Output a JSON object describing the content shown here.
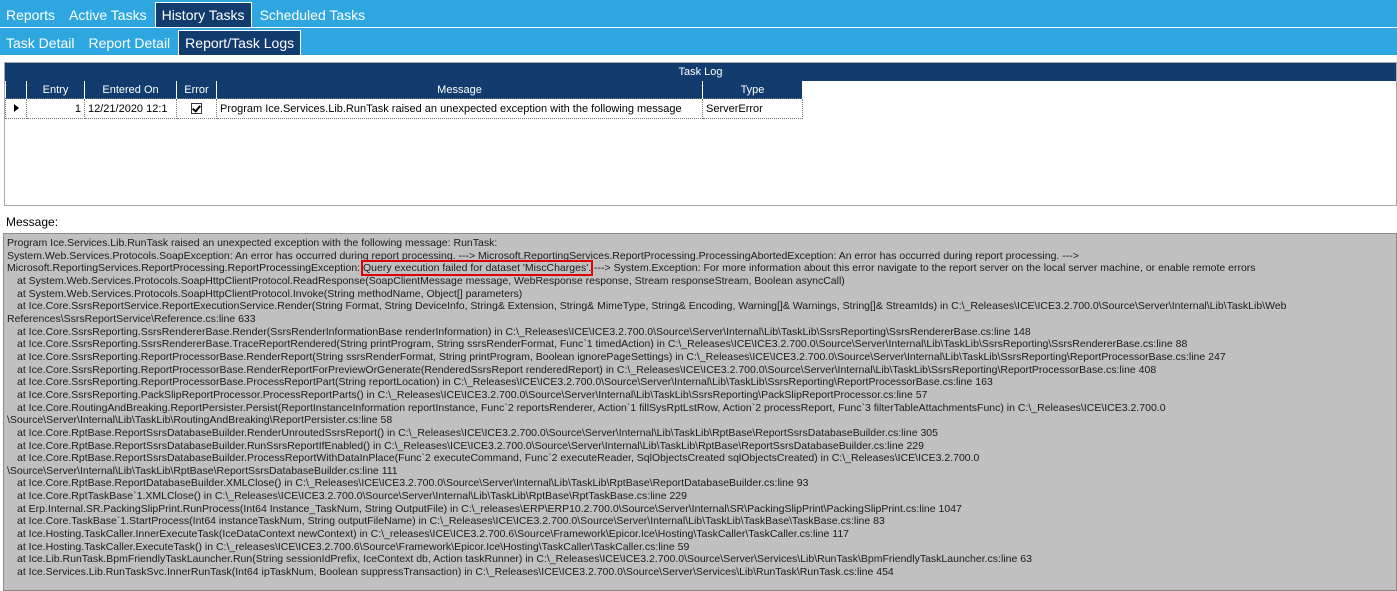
{
  "top_tabs": [
    {
      "label": "Reports",
      "active": false
    },
    {
      "label": "Active Tasks",
      "active": false
    },
    {
      "label": "History Tasks",
      "active": true
    },
    {
      "label": "Scheduled Tasks",
      "active": false
    }
  ],
  "sub_tabs": [
    {
      "label": "Task Detail",
      "active": false
    },
    {
      "label": "Report Detail",
      "active": false
    },
    {
      "label": "Report/Task Logs",
      "active": true
    }
  ],
  "task_log": {
    "caption": "Task Log",
    "columns": [
      "Entry",
      "Entered On",
      "Error",
      "Message",
      "Type"
    ],
    "rows": [
      {
        "entry": "1",
        "entered_on": "12/21/2020 12:1",
        "error": true,
        "message": "Program Ice.Services.Lib.RunTask raised an unexpected exception with the following message",
        "type": "ServerError"
      }
    ]
  },
  "message_label": "Message:",
  "message": {
    "l1": "Program Ice.Services.Lib.RunTask raised an unexpected exception with the following message: RunTask:",
    "l2": "System.Web.Services.Protocols.SoapException: An error has occurred during report processing. ---> Microsoft.ReportingServices.ReportProcessing.ProcessingAbortedException: An error has occurred during report processing. --->",
    "l3a": "Microsoft.ReportingServices.ReportProcessing.ReportProcessingException:",
    "l3b": "Query execution failed for dataset 'MiscCharges'.",
    "l3c": "---> System.Exception: For more information about this error navigate to the report server on the local server machine, or enable remote errors",
    "l4": "at System.Web.Services.Protocols.SoapHttpClientProtocol.ReadResponse(SoapClientMessage message, WebResponse response, Stream responseStream, Boolean asyncCall)",
    "l5": "at System.Web.Services.Protocols.SoapHttpClientProtocol.Invoke(String methodName, Object[] parameters)",
    "l6": "at Ice.Core.SsrsReportService.ReportExecutionService.Render(String Format, String DeviceInfo, String& Extension, String& MimeType, String& Encoding, Warning[]& Warnings, String[]& StreamIds) in C:\\_Releases\\ICE\\ICE3.2.700.0\\Source\\Server\\Internal\\Lib\\TaskLib\\Web",
    "l7": "References\\SsrsReportService\\Reference.cs:line 633",
    "l8": "at Ice.Core.SsrsReporting.SsrsRendererBase.Render(SsrsRenderInformationBase renderInformation) in C:\\_Releases\\ICE\\ICE3.2.700.0\\Source\\Server\\Internal\\Lib\\TaskLib\\SsrsReporting\\SsrsRendererBase.cs:line 148",
    "l9": "at Ice.Core.SsrsReporting.SsrsRendererBase.TraceReportRendered(String printProgram, String ssrsRenderFormat, Func`1 timedAction) in C:\\_Releases\\ICE\\ICE3.2.700.0\\Source\\Server\\Internal\\Lib\\TaskLib\\SsrsReporting\\SsrsRendererBase.cs:line 88",
    "l10": "at Ice.Core.SsrsReporting.ReportProcessorBase.RenderReport(String ssrsRenderFormat, String printProgram, Boolean ignorePageSettings) in C:\\_Releases\\ICE\\ICE3.2.700.0\\Source\\Server\\Internal\\Lib\\TaskLib\\SsrsReporting\\ReportProcessorBase.cs:line 247",
    "l11": "at Ice.Core.SsrsReporting.ReportProcessorBase.RenderReportForPreviewOrGenerate(RenderedSsrsReport renderedReport) in C:\\_Releases\\ICE\\ICE3.2.700.0\\Source\\Server\\Internal\\Lib\\TaskLib\\SsrsReporting\\ReportProcessorBase.cs:line 408",
    "l12": "at Ice.Core.SsrsReporting.ReportProcessorBase.ProcessReportPart(String reportLocation) in C:\\_Releases\\ICE\\ICE3.2.700.0\\Source\\Server\\Internal\\Lib\\TaskLib\\SsrsReporting\\ReportProcessorBase.cs:line 163",
    "l13": "at Ice.Core.SsrsReporting.PackSlipReportProcessor.ProcessReportParts() in C:\\_Releases\\ICE\\ICE3.2.700.0\\Source\\Server\\Internal\\Lib\\TaskLib\\SsrsReporting\\PackSlipReportProcessor.cs:line 57",
    "l14": "at Ice.Core.RoutingAndBreaking.ReportPersister.Persist(ReportInstanceInformation reportInstance, Func`2 reportsRenderer, Action`1 fillSysRptLstRow, Action`2 processReport, Func`3 filterTableAttachmentsFunc) in C:\\_Releases\\ICE\\ICE3.2.700.0",
    "l15": "\\Source\\Server\\Internal\\Lib\\TaskLib\\RoutingAndBreaking\\ReportPersister.cs:line 58",
    "l16": "at Ice.Core.RptBase.ReportSsrsDatabaseBuilder.RenderUnroutedSsrsReport() in C:\\_Releases\\ICE\\ICE3.2.700.0\\Source\\Server\\Internal\\Lib\\TaskLib\\RptBase\\ReportSsrsDatabaseBuilder.cs:line 305",
    "l17": "at Ice.Core.RptBase.ReportSsrsDatabaseBuilder.RunSsrsReportIfEnabled() in C:\\_Releases\\ICE\\ICE3.2.700.0\\Source\\Server\\Internal\\Lib\\TaskLib\\RptBase\\ReportSsrsDatabaseBuilder.cs:line 229",
    "l18": "at Ice.Core.RptBase.ReportSsrsDatabaseBuilder.ProcessReportWithDataInPlace(Func`2 executeCommand, Func`2 executeReader, SqlObjectsCreated sqlObjectsCreated) in C:\\_Releases\\ICE\\ICE3.2.700.0",
    "l19": "\\Source\\Server\\Internal\\Lib\\TaskLib\\RptBase\\ReportSsrsDatabaseBuilder.cs:line 111",
    "l20": "at Ice.Core.RptBase.ReportDatabaseBuilder.XMLClose() in C:\\_Releases\\ICE\\ICE3.2.700.0\\Source\\Server\\Internal\\Lib\\TaskLib\\RptBase\\ReportDatabaseBuilder.cs:line 93",
    "l21": "at Ice.Core.RptTaskBase`1.XMLClose() in C:\\_Releases\\ICE\\ICE3.2.700.0\\Source\\Server\\Internal\\Lib\\TaskLib\\RptBase\\RptTaskBase.cs:line 229",
    "l22": "at Erp.Internal.SR.PackingSlipPrint.RunProcess(Int64 Instance_TaskNum, String OutputFile) in C:\\_releases\\ERP\\ERP10.2.700.0\\Source\\Server\\Internal\\SR\\PackingSlipPrint\\PackingSlipPrint.cs:line 1047",
    "l23": "at Ice.Core.TaskBase`1.StartProcess(Int64 instanceTaskNum, String outputFileName) in C:\\_Releases\\ICE\\ICE3.2.700.0\\Source\\Server\\Internal\\Lib\\TaskLib\\TaskBase\\TaskBase.cs:line 83",
    "l24": "at Ice.Hosting.TaskCaller.InnerExecuteTask(IceDataContext newContext) in C:\\_releases\\ICE\\ICE3.2.700.6\\Source\\Framework\\Epicor.Ice\\Hosting\\TaskCaller\\TaskCaller.cs:line 117",
    "l25": "at Ice.Hosting.TaskCaller.ExecuteTask() in C:\\_releases\\ICE\\ICE3.2.700.6\\Source\\Framework\\Epicor.Ice\\Hosting\\TaskCaller\\TaskCaller.cs:line 59",
    "l26": "at Ice.Lib.RunTask.BpmFriendlyTaskLauncher.Run(String sessionIdPrefix, IceContext db, Action taskRunner) in C:\\_Releases\\ICE\\ICE3.2.700.0\\Source\\Server\\Services\\Lib\\RunTask\\BpmFriendlyTaskLauncher.cs:line 63",
    "l27": "at Ice.Services.Lib.RunTaskSvc.InnerRunTask(Int64 ipTaskNum, Boolean suppressTransaction) in C:\\_Releases\\ICE\\ICE3.2.700.0\\Source\\Server\\Services\\Lib\\RunTask\\RunTask.cs:line 454"
  }
}
